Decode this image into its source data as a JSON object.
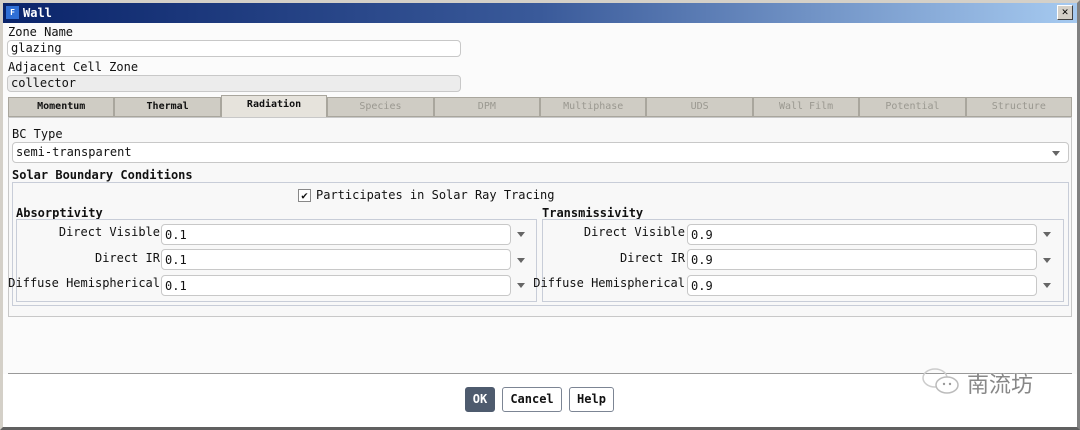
{
  "window": {
    "title": "Wall",
    "close": "✕",
    "app_icon": "F"
  },
  "zone_name": {
    "label": "Zone Name",
    "value": "glazing"
  },
  "adjacent": {
    "label": "Adjacent Cell Zone",
    "value": "collector"
  },
  "tabs": [
    {
      "label": "Momentum"
    },
    {
      "label": "Thermal"
    },
    {
      "label": "Radiation"
    },
    {
      "label": "Species"
    },
    {
      "label": "DPM"
    },
    {
      "label": "Multiphase"
    },
    {
      "label": "UDS"
    },
    {
      "label": "Wall Film"
    },
    {
      "label": "Potential"
    },
    {
      "label": "Structure"
    }
  ],
  "bc_type": {
    "label": "BC Type",
    "value": "semi-transparent"
  },
  "solar": {
    "heading": "Solar Boundary Conditions",
    "checkbox_label": "Participates in Solar Ray Tracing",
    "checked": true
  },
  "absorptivity": {
    "heading": "Absorptivity",
    "rows": [
      {
        "label": "Direct Visible",
        "value": "0.1"
      },
      {
        "label": "Direct IR",
        "value": "0.1"
      },
      {
        "label": "Diffuse Hemispherical",
        "value": "0.1"
      }
    ]
  },
  "transmissivity": {
    "heading": "Transmissivity",
    "rows": [
      {
        "label": "Direct Visible",
        "value": "0.9"
      },
      {
        "label": "Direct IR",
        "value": "0.9"
      },
      {
        "label": "Diffuse Hemispherical",
        "value": "0.9"
      }
    ]
  },
  "buttons": {
    "ok": "OK",
    "cancel": "Cancel",
    "help": "Help"
  },
  "watermark": "南流坊"
}
